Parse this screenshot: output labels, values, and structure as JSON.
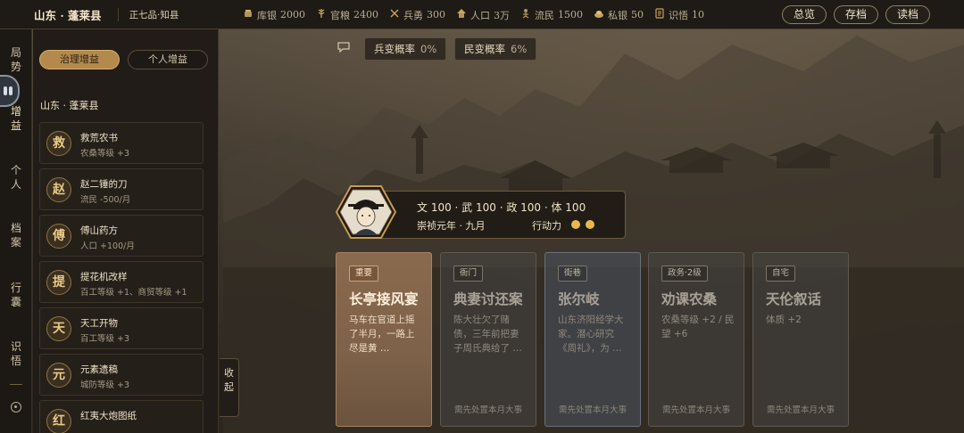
{
  "header": {
    "location": "山东 · 蓬莱县",
    "rank": "正七品·知县",
    "stats": [
      {
        "icon": "treasury-icon",
        "label": "库银",
        "value": "2000"
      },
      {
        "icon": "grain-icon",
        "label": "官粮",
        "value": "2400"
      },
      {
        "icon": "soldier-icon",
        "label": "兵勇",
        "value": "300"
      },
      {
        "icon": "population-icon",
        "label": "人口",
        "value": "3万"
      },
      {
        "icon": "refugee-icon",
        "label": "流民",
        "value": "1500"
      },
      {
        "icon": "private-silver-icon",
        "label": "私银",
        "value": "50"
      },
      {
        "icon": "insight-icon",
        "label": "识悟",
        "value": "10"
      }
    ],
    "buttons": {
      "overview": "总览",
      "save": "存档",
      "load": "读档"
    }
  },
  "nav": {
    "items": [
      {
        "label": "局\n势",
        "active": false
      },
      {
        "label": "增\n益",
        "active": true
      },
      {
        "label": "个\n人",
        "active": false
      },
      {
        "label": "档\n案",
        "active": false
      },
      {
        "label": "行\n囊",
        "active": false
      },
      {
        "label": "识\n悟",
        "active": false
      }
    ]
  },
  "panel": {
    "tabs": {
      "governance": "治理增益",
      "personal": "个人增益"
    },
    "region": "山东 · 蓬莱县",
    "items": [
      {
        "badge": "救",
        "title": "救荒农书",
        "desc": "农桑等级 +3"
      },
      {
        "badge": "赵",
        "title": "赵二锤的刀",
        "desc": "流民 -500/月"
      },
      {
        "badge": "傅",
        "title": "傅山药方",
        "desc": "人口 +100/月"
      },
      {
        "badge": "提",
        "title": "提花机改样",
        "desc": "百工等级 +1、商贸等级 +1"
      },
      {
        "badge": "天",
        "title": "天工开物",
        "desc": "百工等级 +3"
      },
      {
        "badge": "元",
        "title": "元素遗稿",
        "desc": "城防等级 +3"
      },
      {
        "badge": "红",
        "title": "红夷大炮图纸",
        "desc": ""
      }
    ],
    "collapse_label": "收\n起"
  },
  "risks": {
    "mutiny_label": "兵变概率",
    "mutiny_value": "0%",
    "uprising_label": "民变概率",
    "uprising_value": "6%"
  },
  "character": {
    "attrs": "文 100 · 武 100 · 政 100 · 体 100",
    "date": "崇祯元年 · 九月",
    "action_label": "行动力",
    "action_points": 2
  },
  "cards": [
    {
      "tag": "重要",
      "title": "长亭接风宴",
      "desc": "马车在官道上摇了半月，一路上尽是黄 …",
      "foot": "",
      "style": "featured"
    },
    {
      "tag": "衙门",
      "title": "典妻讨还案",
      "desc": "陈大壮欠了赌债，三年前把妻子周氏典给了 …",
      "foot": "需先处置本月大事",
      "style": "grey"
    },
    {
      "tag": "街巷",
      "title": "张尔岐",
      "desc": "山东济阳经学大家。潜心研究《周礼》，为 …",
      "foot": "需先处置本月大事",
      "style": "slate"
    },
    {
      "tag": "政务·2级",
      "title": "劝课农桑",
      "desc": "农桑等级 +2 / 民望 +6",
      "foot": "需先处置本月大事",
      "style": "grey"
    },
    {
      "tag": "自宅",
      "title": "天伦叙话",
      "desc": "体质 +2",
      "foot": "需先处置本月大事",
      "style": "grey"
    }
  ]
}
